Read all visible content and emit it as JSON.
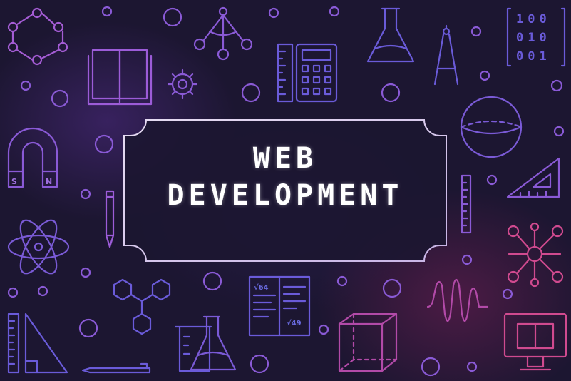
{
  "banner": {
    "line1": "WEB",
    "line2": "DEVELOPMENT"
  },
  "magnet": {
    "south": "S",
    "north": "N"
  },
  "binary_card": {
    "rows": [
      "100",
      "010",
      "001"
    ]
  },
  "notebook": {
    "math_a": "√64",
    "math_b": "√49"
  },
  "colors": {
    "background": "#1c1631",
    "line_violet": "#7d5bd8",
    "line_blue": "#5a5bd9",
    "line_pink": "#d04a8f",
    "frame": "#d8cde8",
    "text": "#ffffff"
  },
  "icons": [
    "circle-network-icon",
    "book-icon",
    "gear-icon",
    "pendulum-icon",
    "ruler-icon",
    "calculator-icon",
    "flask-icon",
    "compass-icon",
    "binary-card-icon",
    "magnet-icon",
    "globe-icon",
    "set-square-icon",
    "pencil-icon",
    "atom-icon",
    "molecule-icon",
    "hexagon-molecule-icon",
    "notebook-math-icon",
    "sound-wave-icon",
    "beaker-icon",
    "erlenmeyer-flask-icon",
    "cube-icon",
    "monitor-book-icon",
    "triangle-ruler-icon",
    "pen-icon"
  ]
}
